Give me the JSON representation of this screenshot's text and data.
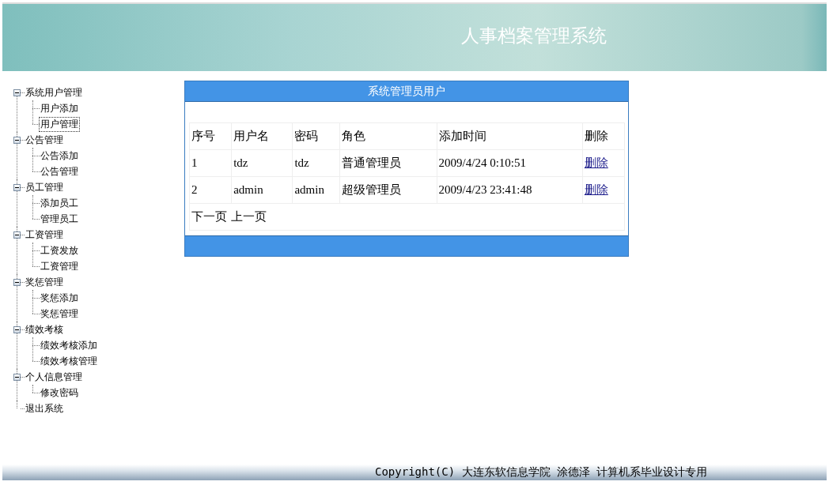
{
  "header": {
    "title": "人事档案管理系统"
  },
  "sidebar": {
    "items": [
      {
        "label": "系统用户管理",
        "expanded": true,
        "selected": false,
        "children": [
          {
            "label": "用户添加",
            "selected": false
          },
          {
            "label": "用户管理",
            "selected": true
          }
        ]
      },
      {
        "label": "公告管理",
        "expanded": true,
        "selected": false,
        "children": [
          {
            "label": "公告添加",
            "selected": false
          },
          {
            "label": "公告管理",
            "selected": false
          }
        ]
      },
      {
        "label": "员工管理",
        "expanded": true,
        "selected": false,
        "children": [
          {
            "label": "添加员工",
            "selected": false
          },
          {
            "label": "管理员工",
            "selected": false
          }
        ]
      },
      {
        "label": "工资管理",
        "expanded": true,
        "selected": false,
        "children": [
          {
            "label": "工资发放",
            "selected": false
          },
          {
            "label": "工资管理",
            "selected": false
          }
        ]
      },
      {
        "label": "奖惩管理",
        "expanded": true,
        "selected": false,
        "children": [
          {
            "label": "奖惩添加",
            "selected": false
          },
          {
            "label": "奖惩管理",
            "selected": false
          }
        ]
      },
      {
        "label": "绩效考核",
        "expanded": true,
        "selected": false,
        "children": [
          {
            "label": "绩效考核添加",
            "selected": false
          },
          {
            "label": "绩效考核管理",
            "selected": false
          }
        ]
      },
      {
        "label": "个人信息管理",
        "expanded": true,
        "selected": false,
        "children": [
          {
            "label": "修改密码",
            "selected": false
          }
        ]
      },
      {
        "label": "退出系统",
        "selected": false
      }
    ]
  },
  "panel": {
    "title": "系统管理员用户",
    "table": {
      "columns": [
        "序号",
        "用户名",
        "密码",
        "角色",
        "添加时间",
        "删除"
      ],
      "rows": [
        {
          "cells": [
            "1",
            "tdz",
            "tdz",
            "普通管理员",
            "2009/4/24 0:10:51"
          ],
          "action": "删除"
        },
        {
          "cells": [
            "2",
            "admin",
            "admin",
            "超级管理员",
            "2009/4/23 23:41:48"
          ],
          "action": "删除"
        }
      ]
    },
    "pager": [
      "下一页",
      "上一页"
    ]
  },
  "footer": {
    "text": "Copyright(C) 大连东软信息学院 涂德泽 计算机系毕业设计专用"
  }
}
